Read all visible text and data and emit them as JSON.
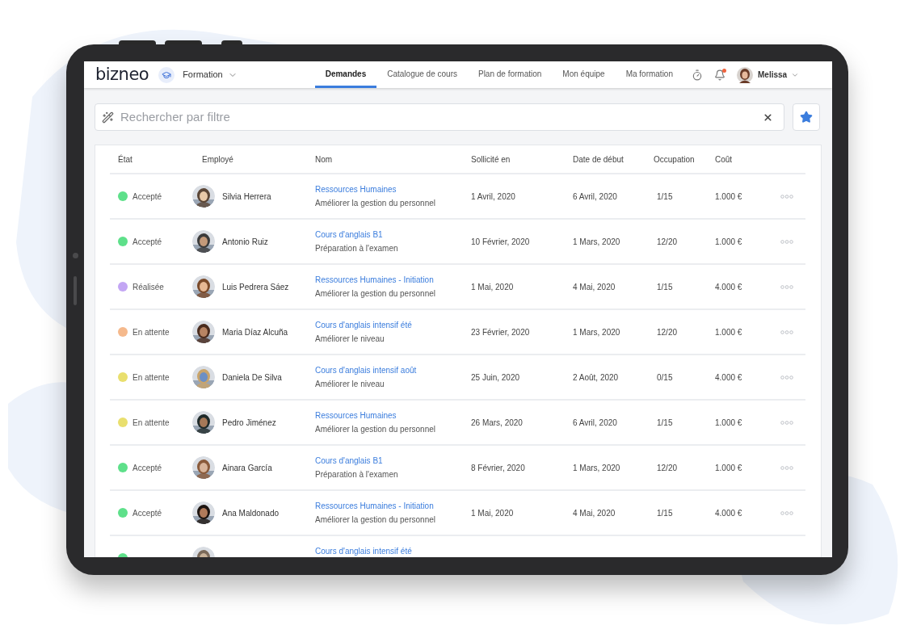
{
  "app": {
    "logo": "bizneo",
    "module": "Formation"
  },
  "tabs": [
    {
      "label": "Demandes",
      "selected": true
    },
    {
      "label": "Catalogue de cours",
      "selected": false
    },
    {
      "label": "Plan de formation",
      "selected": false
    },
    {
      "label": "Mon équipe",
      "selected": false
    },
    {
      "label": "Ma formation",
      "selected": false
    }
  ],
  "user": {
    "name": "Melissa",
    "has_notification": true
  },
  "search": {
    "placeholder": "Rechercher par filtre"
  },
  "table": {
    "columns": [
      "État",
      "Employé",
      "Nom",
      "Sollicité en",
      "Date de début",
      "Occupation",
      "Coût"
    ],
    "rows": [
      {
        "status": "Accepté",
        "color": "#5ee08a",
        "employee": "Silvia Herrera",
        "course": "Ressources Humaines",
        "description": "Améliorer la gestion du personnel",
        "requested": "1 Avril, 2020",
        "start": "6 Avril, 2020",
        "occupation": "1/15",
        "cost": "1.000 €"
      },
      {
        "status": "Accepté",
        "color": "#5ee08a",
        "employee": "Antonio Ruiz",
        "course": "Cours d'anglais B1",
        "description": "Préparation à l'examen",
        "requested": "10 Février, 2020",
        "start": "1 Mars, 2020",
        "occupation": "12/20",
        "cost": "1.000 €"
      },
      {
        "status": "Réalisée",
        "color": "#c3a6f4",
        "employee": "Luis Pedrera Sáez",
        "course": "Ressources Humaines - Initiation",
        "description": "Améliorer la gestion du personnel",
        "requested": "1 Mai, 2020",
        "start": "4 Mai, 2020",
        "occupation": "1/15",
        "cost": "4.000 €"
      },
      {
        "status": "En attente",
        "color": "#f5b98c",
        "employee": "Maria Díaz Alcuña",
        "course": "Cours d'anglais intensif été",
        "description": "Améliorer le niveau",
        "requested": "23 Février, 2020",
        "start": "1 Mars, 2020",
        "occupation": "12/20",
        "cost": "1.000 €"
      },
      {
        "status": "En attente",
        "color": "#e9df6e",
        "employee": "Daniela De Silva",
        "course": "Cours d'anglais intensif août",
        "description": "Améliorer le niveau",
        "requested": "25 Juin, 2020",
        "start": "2 Août, 2020",
        "occupation": "0/15",
        "cost": "4.000 €"
      },
      {
        "status": "En attente",
        "color": "#e9df6e",
        "employee": "Pedro Jiménez",
        "course": "Ressources Humaines",
        "description": "Améliorer la gestion du personnel",
        "requested": "26 Mars, 2020",
        "start": "6 Avril, 2020",
        "occupation": "1/15",
        "cost": "1.000 €"
      },
      {
        "status": "Accepté",
        "color": "#5ee08a",
        "employee": "Ainara García",
        "course": "Cours d'anglais B1",
        "description": "Préparation à l'examen",
        "requested": "8 Février, 2020",
        "start": "1 Mars, 2020",
        "occupation": "12/20",
        "cost": "1.000 €"
      },
      {
        "status": "Accepté",
        "color": "#5ee08a",
        "employee": "Ana Maldonado",
        "course": "Ressources Humaines - Initiation",
        "description": "Améliorer la gestion du personnel",
        "requested": "1 Mai, 2020",
        "start": "4 Mai, 2020",
        "occupation": "1/15",
        "cost": "4.000 €"
      },
      {
        "color": "#5ee08a",
        "course": "Cours d'anglais intensif été"
      }
    ]
  }
}
